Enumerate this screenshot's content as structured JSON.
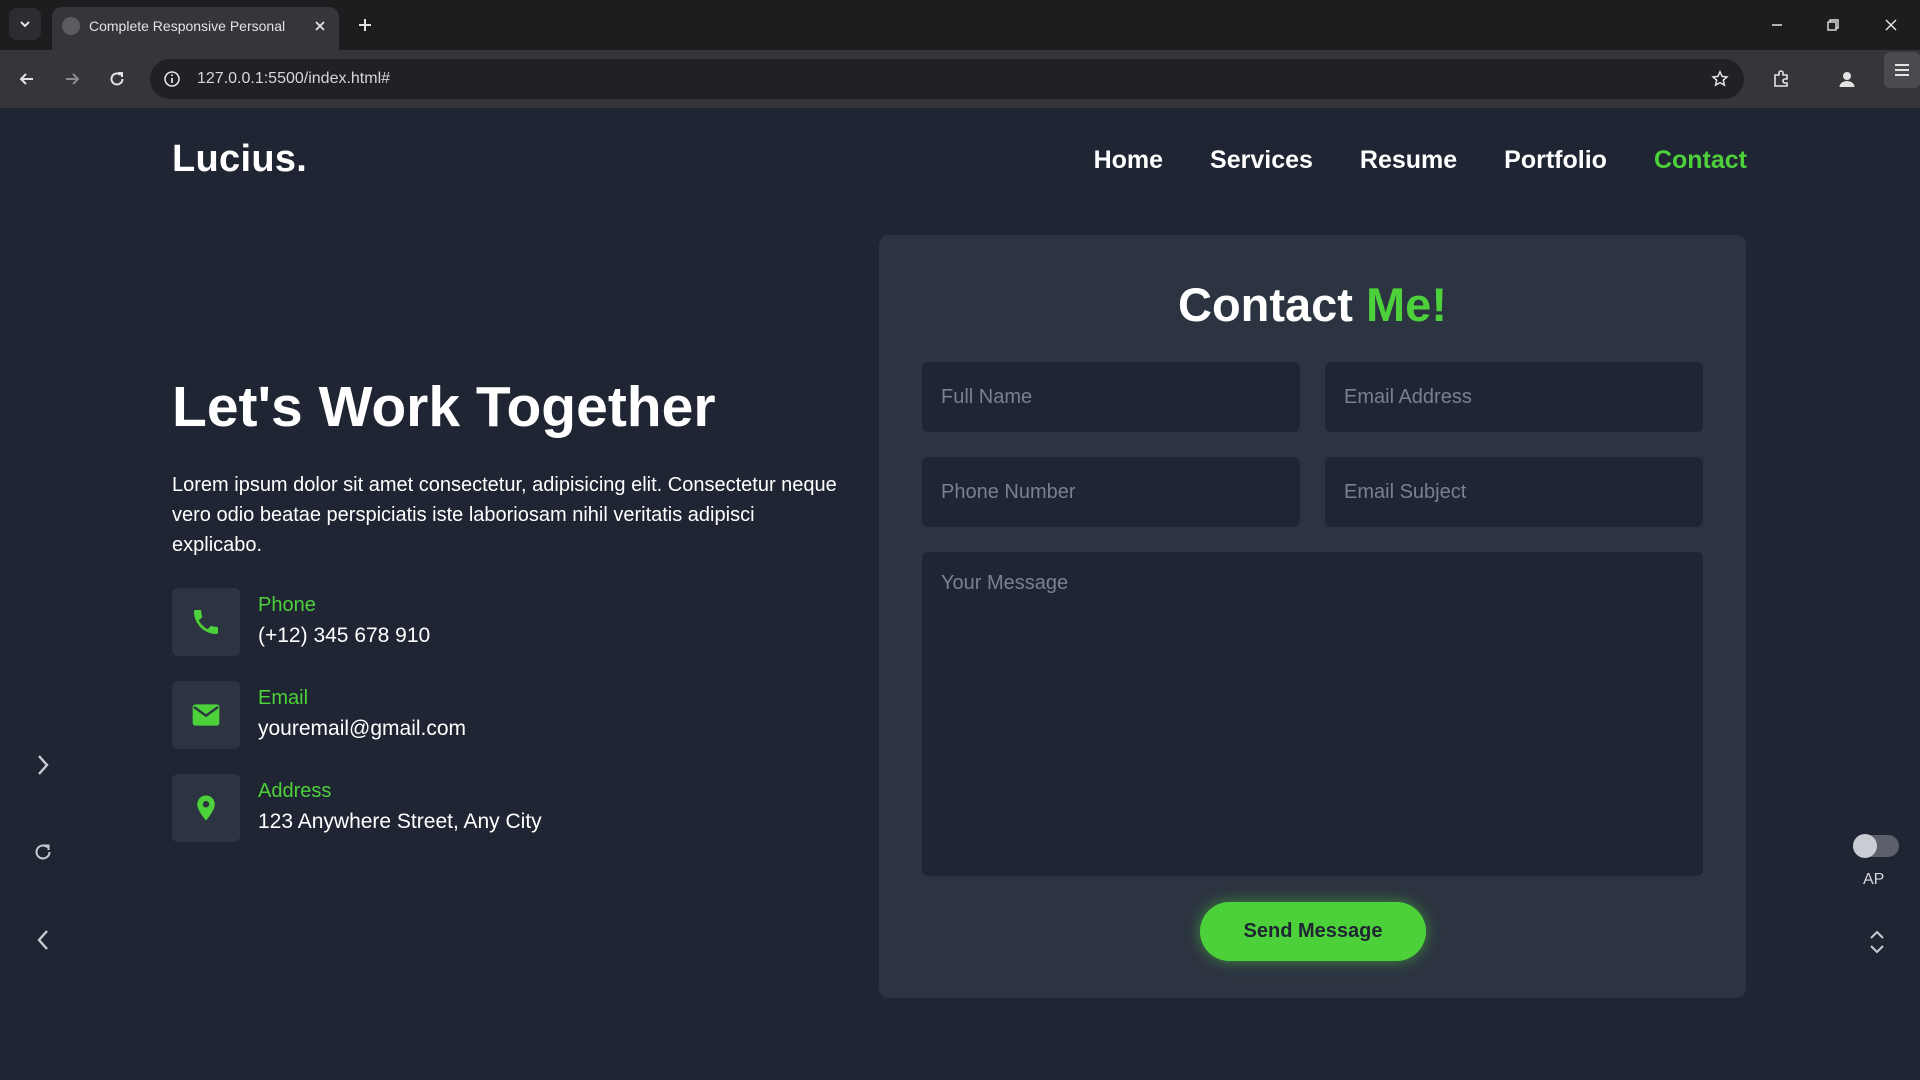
{
  "browser": {
    "tab_title": "Complete Responsive Personal",
    "url": "127.0.0.1:5500/index.html#"
  },
  "header": {
    "logo": "Lucius.",
    "nav": [
      {
        "label": "Home",
        "active": false
      },
      {
        "label": "Services",
        "active": false
      },
      {
        "label": "Resume",
        "active": false
      },
      {
        "label": "Portfolio",
        "active": false
      },
      {
        "label": "Contact",
        "active": true
      }
    ]
  },
  "hero": {
    "title": "Let's Work Together",
    "description": "Lorem ipsum dolor sit amet consectetur, adipisicing elit. Consectetur neque vero odio beatae perspiciatis iste laboriosam nihil veritatis adipisci explicabo."
  },
  "contact_info": [
    {
      "icon": "phone-icon",
      "label": "Phone",
      "value": "(+12) 345 678 910"
    },
    {
      "icon": "mail-icon",
      "label": "Email",
      "value": "youremail@gmail.com"
    },
    {
      "icon": "location-pin-icon",
      "label": "Address",
      "value": "123 Anywhere Street, Any City"
    }
  ],
  "form": {
    "title_main": "Contact",
    "title_accent": "Me!",
    "placeholders": {
      "full_name": "Full Name",
      "email": "Email Address",
      "phone": "Phone Number",
      "subject": "Email Subject",
      "message": "Your Message"
    },
    "submit_label": "Send Message"
  },
  "side_widget": {
    "toggle_label": "AP"
  },
  "colors": {
    "accent": "#4cd13b",
    "background": "#1f2532",
    "card": "#2d3441"
  }
}
